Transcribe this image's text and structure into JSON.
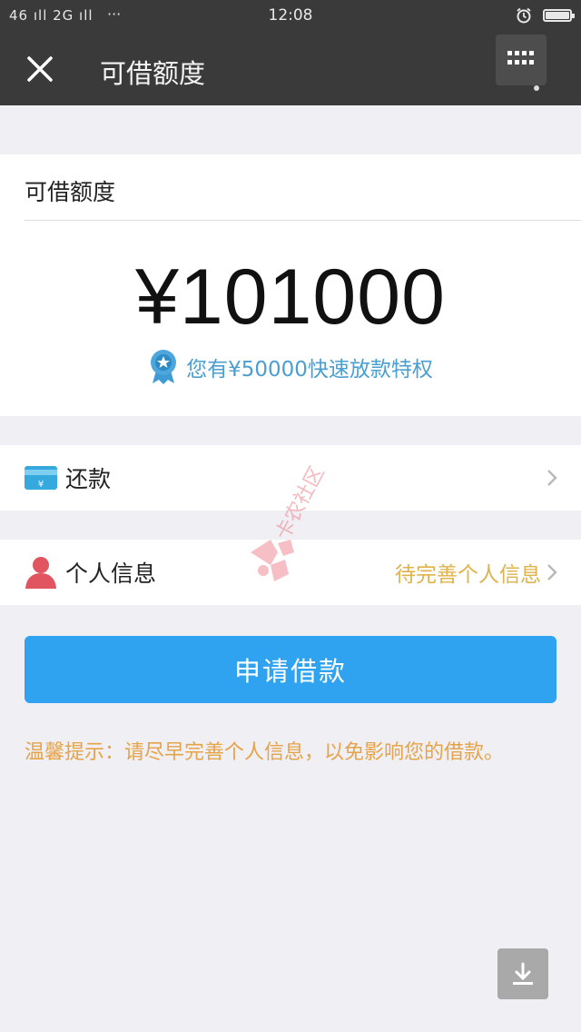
{
  "status_bar": {
    "signal_text": "46 ıll  2G ıll",
    "more_text": "···",
    "time": "12:08"
  },
  "nav": {
    "title": "可借额度",
    "close_icon": "close-icon",
    "more_icon": "grid-menu-icon"
  },
  "credit": {
    "label": "可借额度",
    "amount": "¥101000",
    "privilege_text": "您有¥50000快速放款特权",
    "badge_icon": "medal-badge-icon"
  },
  "repay": {
    "label": "还款",
    "icon": "card-icon"
  },
  "personal_info": {
    "label": "个人信息",
    "status": "待完善个人信息",
    "icon": "person-icon"
  },
  "apply_button": {
    "label": "申请借款"
  },
  "tip": {
    "text": "温馨提示：请尽早完善个人信息，以免影响您的借款。"
  },
  "watermark": {
    "text": "卡农社区"
  },
  "colors": {
    "header_bg": "#3a3a3a",
    "accent_blue": "#2fa3ef",
    "privilege_blue": "#4a9fd0",
    "tip_orange": "#e7a347",
    "status_yellow": "#e0b24a",
    "person_red": "#e05560",
    "page_bg": "#efeff4"
  }
}
